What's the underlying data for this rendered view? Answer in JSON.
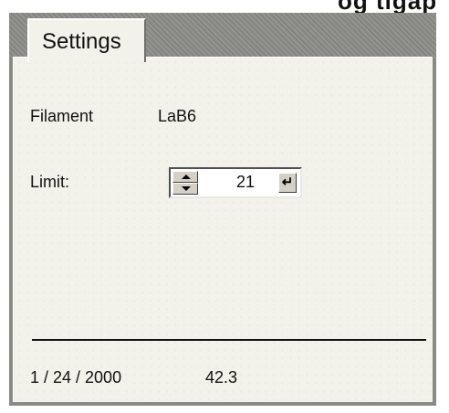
{
  "header_fragment": "og tigap",
  "tab": {
    "label": "Settings"
  },
  "filament": {
    "label": "Filament",
    "value": "LaB6"
  },
  "limit": {
    "label": "Limit:",
    "value": "21",
    "enter_icon": "enter-icon",
    "spin_icons": [
      "spin-up-icon",
      "spin-down-icon"
    ]
  },
  "status": {
    "date": "1 / 24 / 2000",
    "reading": "42.3"
  },
  "colors": {
    "panel_bg": "#f3f2ea",
    "frame": "#8a8a86",
    "text": "#111111"
  }
}
